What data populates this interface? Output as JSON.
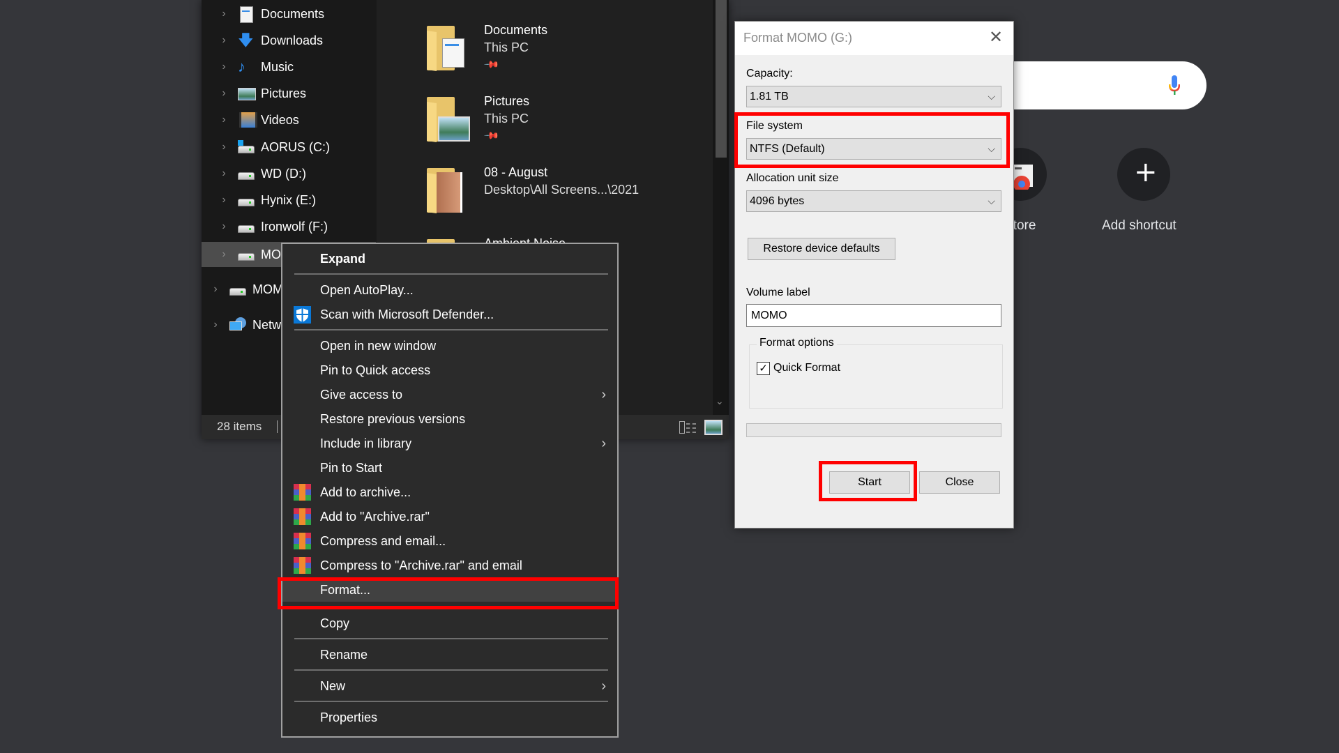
{
  "chrome": {
    "shortcuts": [
      {
        "label": "Store",
        "icon": "web-store-icon"
      },
      {
        "label": "Add shortcut",
        "icon": "plus-icon"
      }
    ],
    "search_icon": "microphone-icon"
  },
  "explorer": {
    "nav_items": [
      {
        "label": "Documents",
        "icon": "documents-icon"
      },
      {
        "label": "Downloads",
        "icon": "downloads-icon"
      },
      {
        "label": "Music",
        "icon": "music-icon"
      },
      {
        "label": "Pictures",
        "icon": "pictures-icon"
      },
      {
        "label": "Videos",
        "icon": "videos-icon"
      },
      {
        "label": "AORUS (C:)",
        "icon": "system-drive-icon"
      },
      {
        "label": "WD (D:)",
        "icon": "drive-icon"
      },
      {
        "label": "Hynix (E:)",
        "icon": "drive-icon"
      },
      {
        "label": "Ironwolf (F:)",
        "icon": "drive-icon"
      },
      {
        "label": "MOMO (G:)",
        "visible_label": "MO",
        "icon": "drive-icon",
        "selected": true
      },
      {
        "label": "MOMO",
        "visible_label": "MOM",
        "icon": "drive-icon"
      },
      {
        "label": "Network",
        "visible_label": "Netw",
        "icon": "network-icon"
      }
    ],
    "quick_access": [
      {
        "name": "Documents",
        "location": "This PC",
        "pinned": true
      },
      {
        "name": "Pictures",
        "location": "This PC",
        "pinned": true
      },
      {
        "name": "08 - August",
        "location": "Desktop\\All Screens...\\2021",
        "pinned": false
      },
      {
        "name": "Ambient Noise",
        "location": "",
        "pinned": false
      }
    ],
    "status": {
      "item_count": "28 items"
    }
  },
  "context_menu": {
    "items": [
      {
        "label": "Expand",
        "bold": true
      },
      {
        "separator": true
      },
      {
        "label": "Open AutoPlay..."
      },
      {
        "label": "Scan with Microsoft Defender...",
        "icon": "defender-shield-icon"
      },
      {
        "separator": true
      },
      {
        "label": "Open in new window"
      },
      {
        "label": "Pin to Quick access"
      },
      {
        "label": "Give access to",
        "submenu": true
      },
      {
        "label": "Restore previous versions"
      },
      {
        "label": "Include in library",
        "submenu": true
      },
      {
        "label": "Pin to Start"
      },
      {
        "label": "Add to archive...",
        "icon": "winrar-icon"
      },
      {
        "label": "Add to \"Archive.rar\"",
        "icon": "winrar-icon"
      },
      {
        "label": "Compress and email...",
        "icon": "winrar-icon"
      },
      {
        "label": "Compress to \"Archive.rar\" and email",
        "icon": "winrar-icon"
      },
      {
        "label": "Format...",
        "highlighted": true
      },
      {
        "separator": true
      },
      {
        "label": "Copy"
      },
      {
        "separator": true
      },
      {
        "label": "Rename"
      },
      {
        "separator": true
      },
      {
        "label": "New",
        "submenu": true
      },
      {
        "separator": true
      },
      {
        "label": "Properties"
      }
    ]
  },
  "format_dialog": {
    "title": "Format MOMO (G:)",
    "capacity_label": "Capacity:",
    "capacity_value": "1.81 TB",
    "file_system_label": "File system",
    "file_system_value": "NTFS (Default)",
    "allocation_label": "Allocation unit size",
    "allocation_value": "4096 bytes",
    "restore_defaults_label": "Restore device defaults",
    "volume_label_label": "Volume label",
    "volume_label_value": "MOMO",
    "format_options_label": "Format options",
    "quick_format_label": "Quick Format",
    "quick_format_checked": true,
    "progress": 0,
    "start_label": "Start",
    "close_label": "Close"
  },
  "annotation_color": "#ff0000"
}
